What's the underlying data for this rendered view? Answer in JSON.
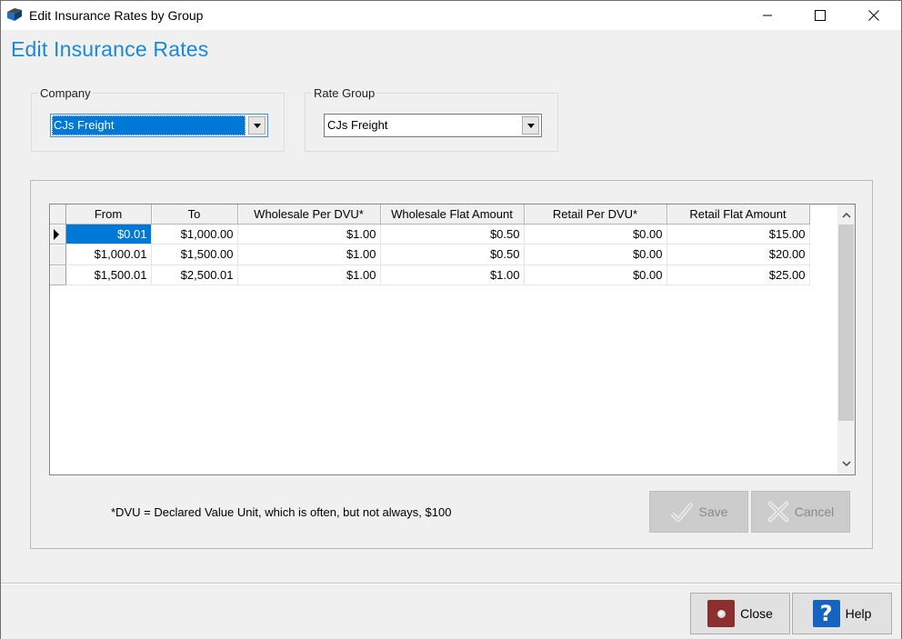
{
  "window": {
    "title": "Edit Insurance Rates by Group",
    "controls": {
      "minimize": "minimize",
      "maximize": "maximize",
      "close": "close"
    }
  },
  "page": {
    "heading": "Edit Insurance Rates"
  },
  "filters": {
    "company": {
      "label": "Company",
      "value": "CJs Freight"
    },
    "rate_group": {
      "label": "Rate Group",
      "value": "CJs Freight"
    }
  },
  "grid": {
    "columns": [
      "From",
      "To",
      "Wholesale Per DVU*",
      "Wholesale Flat Amount",
      "Retail Per DVU*",
      "Retail Flat Amount"
    ],
    "rows": [
      {
        "from": "$0.01",
        "to": "$1,000.00",
        "wholesale_per_dvu": "$1.00",
        "wholesale_flat": "$0.50",
        "retail_per_dvu": "$0.00",
        "retail_flat": "$15.00",
        "current": true
      },
      {
        "from": "$1,000.01",
        "to": "$1,500.00",
        "wholesale_per_dvu": "$1.00",
        "wholesale_flat": "$0.50",
        "retail_per_dvu": "$0.00",
        "retail_flat": "$20.00",
        "current": false
      },
      {
        "from": "$1,500.01",
        "to": "$2,500.01",
        "wholesale_per_dvu": "$1.00",
        "wholesale_flat": "$1.00",
        "retail_per_dvu": "$0.00",
        "retail_flat": "$25.00",
        "current": false
      }
    ]
  },
  "footnote": "*DVU = Declared Value Unit, which is often, but not always, $100",
  "actions": {
    "save_label": "Save",
    "cancel_label": "Cancel",
    "save_enabled": false,
    "cancel_enabled": false
  },
  "footer": {
    "close_label": "Close",
    "help_label": "Help"
  },
  "colors": {
    "heading": "#1a8ad4",
    "selection": "#0078d7",
    "close_icon": "#8b2f2f",
    "help_icon": "#1565c0"
  }
}
